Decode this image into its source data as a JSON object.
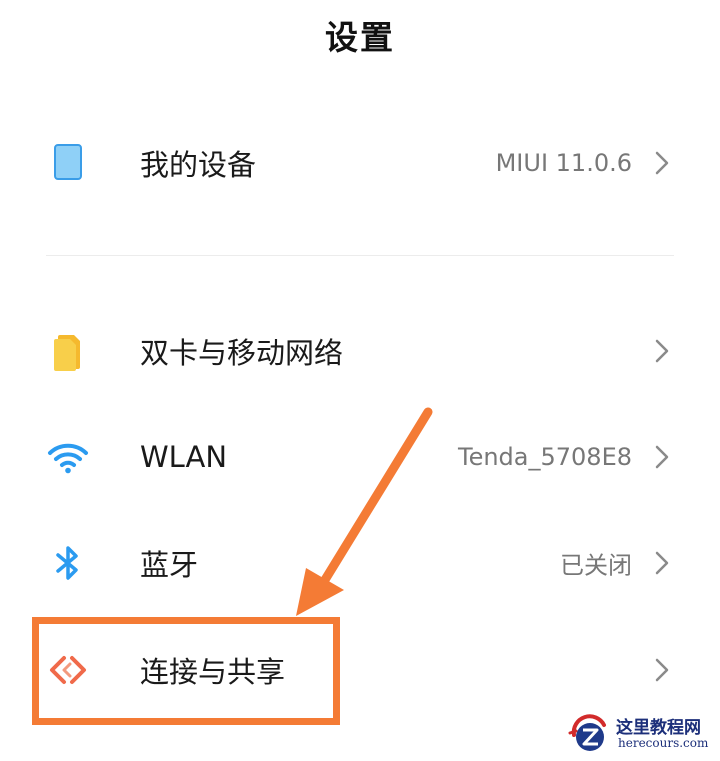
{
  "header": {
    "title": "设置"
  },
  "settings": [
    {
      "label": "我的设备",
      "value": "MIUI 11.0.6",
      "icon": "device-icon"
    },
    {
      "label": "双卡与移动网络",
      "value": "",
      "icon": "sim-card-icon"
    },
    {
      "label": "WLAN",
      "value": "Tenda_5708E8",
      "icon": "wifi-icon"
    },
    {
      "label": "蓝牙",
      "value": "已关闭",
      "icon": "bluetooth-icon"
    },
    {
      "label": "连接与共享",
      "value": "",
      "icon": "connection-share-icon"
    }
  ],
  "watermark": {
    "title": "这里教程网",
    "url": "herecours.com"
  },
  "colors": {
    "accent_orange": "#f47b35",
    "device_icon": "#7cc4f4",
    "sim_icon": "#f6c342",
    "wifi_icon": "#2b9bf0",
    "bluetooth_icon": "#2b9bf0",
    "share_icon": "#f06a4a"
  }
}
